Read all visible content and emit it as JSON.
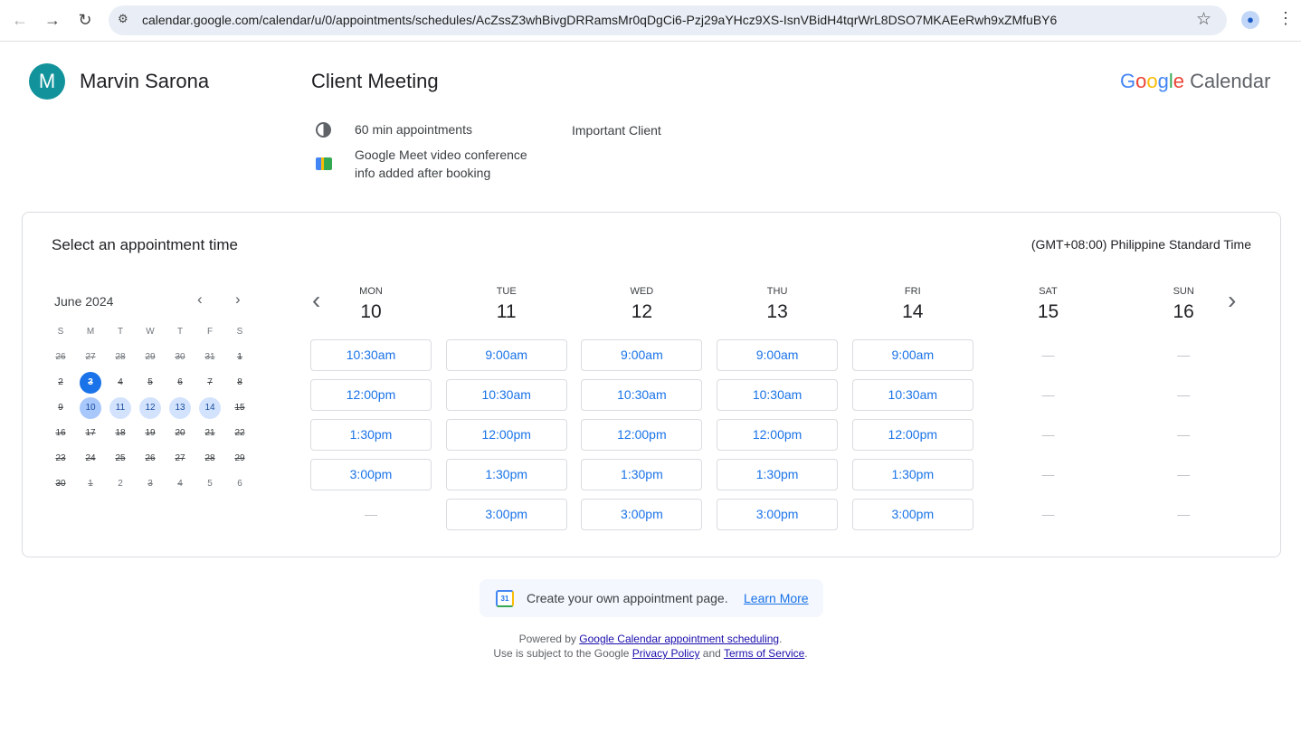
{
  "browser": {
    "url": "calendar.google.com/calendar/u/0/appointments/schedules/AcZssZ3whBivgDRRamsMr0qDgCi6-Pzj29aYHcz9XS-IsnVBidH4tqrWrL8DSO7MKAEeRwh9xZMfuBY6"
  },
  "host": {
    "initial": "M",
    "name": "Marvin Sarona"
  },
  "event": {
    "title": "Client Meeting",
    "duration": "60 min appointments",
    "conference_line1": "Google Meet video conference",
    "conference_line2": "info added after booking",
    "description": "Important Client"
  },
  "brand": {
    "google": "Google",
    "calendar": "Calendar"
  },
  "booking": {
    "heading": "Select an appointment time",
    "timezone": "(GMT+08:00) Philippine Standard Time"
  },
  "mini_calendar": {
    "month": "June 2024",
    "weekdays": [
      "S",
      "M",
      "T",
      "W",
      "T",
      "F",
      "S"
    ],
    "weeks": [
      [
        [
          "26",
          "other-disabled"
        ],
        [
          "27",
          "other-disabled"
        ],
        [
          "28",
          "other-disabled"
        ],
        [
          "29",
          "other-disabled"
        ],
        [
          "30",
          "other-disabled"
        ],
        [
          "31",
          "other-disabled"
        ],
        [
          "1",
          "disabled"
        ]
      ],
      [
        [
          "2",
          "disabled"
        ],
        [
          "3",
          "today-disabled"
        ],
        [
          "4",
          "disabled"
        ],
        [
          "5",
          "disabled"
        ],
        [
          "6",
          "disabled"
        ],
        [
          "7",
          "disabled"
        ],
        [
          "8",
          "disabled"
        ]
      ],
      [
        [
          "9",
          "disabled"
        ],
        [
          "10",
          "selected"
        ],
        [
          "11",
          "available"
        ],
        [
          "12",
          "available"
        ],
        [
          "13",
          "available"
        ],
        [
          "14",
          "available"
        ],
        [
          "15",
          "disabled"
        ]
      ],
      [
        [
          "16",
          "disabled"
        ],
        [
          "17",
          "disabled"
        ],
        [
          "18",
          "disabled"
        ],
        [
          "19",
          "disabled"
        ],
        [
          "20",
          "disabled"
        ],
        [
          "21",
          "disabled"
        ],
        [
          "22",
          "disabled"
        ]
      ],
      [
        [
          "23",
          "disabled"
        ],
        [
          "24",
          "disabled"
        ],
        [
          "25",
          "disabled"
        ],
        [
          "26",
          "disabled"
        ],
        [
          "27",
          "disabled"
        ],
        [
          "28",
          "disabled"
        ],
        [
          "29",
          "disabled"
        ]
      ],
      [
        [
          "30",
          "disabled"
        ],
        [
          "1",
          "other-disabled"
        ],
        [
          "2",
          "other"
        ],
        [
          "3",
          "other-disabled"
        ],
        [
          "4",
          "other-disabled"
        ],
        [
          "5",
          "other"
        ],
        [
          "6",
          "other"
        ]
      ]
    ]
  },
  "week": [
    {
      "dow": "MON",
      "day": "10",
      "slots": [
        "10:30am",
        "12:00pm",
        "1:30pm",
        "3:00pm",
        null
      ]
    },
    {
      "dow": "TUE",
      "day": "11",
      "slots": [
        "9:00am",
        "10:30am",
        "12:00pm",
        "1:30pm",
        "3:00pm"
      ]
    },
    {
      "dow": "WED",
      "day": "12",
      "slots": [
        "9:00am",
        "10:30am",
        "12:00pm",
        "1:30pm",
        "3:00pm"
      ]
    },
    {
      "dow": "THU",
      "day": "13",
      "slots": [
        "9:00am",
        "10:30am",
        "12:00pm",
        "1:30pm",
        "3:00pm"
      ]
    },
    {
      "dow": "FRI",
      "day": "14",
      "slots": [
        "9:00am",
        "10:30am",
        "12:00pm",
        "1:30pm",
        "3:00pm"
      ]
    },
    {
      "dow": "SAT",
      "day": "15",
      "slots": [
        null,
        null,
        null,
        null,
        null
      ]
    },
    {
      "dow": "SUN",
      "day": "16",
      "slots": [
        null,
        null,
        null,
        null,
        null
      ]
    }
  ],
  "empty_slot": "—",
  "promo": {
    "text": "Create your own appointment page.",
    "link": "Learn More",
    "icon_day": "31"
  },
  "footer": {
    "powered": "Powered by ",
    "powered_link": "Google Calendar appointment scheduling",
    "period": ".",
    "use": "Use is subject to the Google ",
    "privacy": "Privacy Policy",
    "and": " and ",
    "terms": "Terms of Service",
    "period2": "."
  }
}
